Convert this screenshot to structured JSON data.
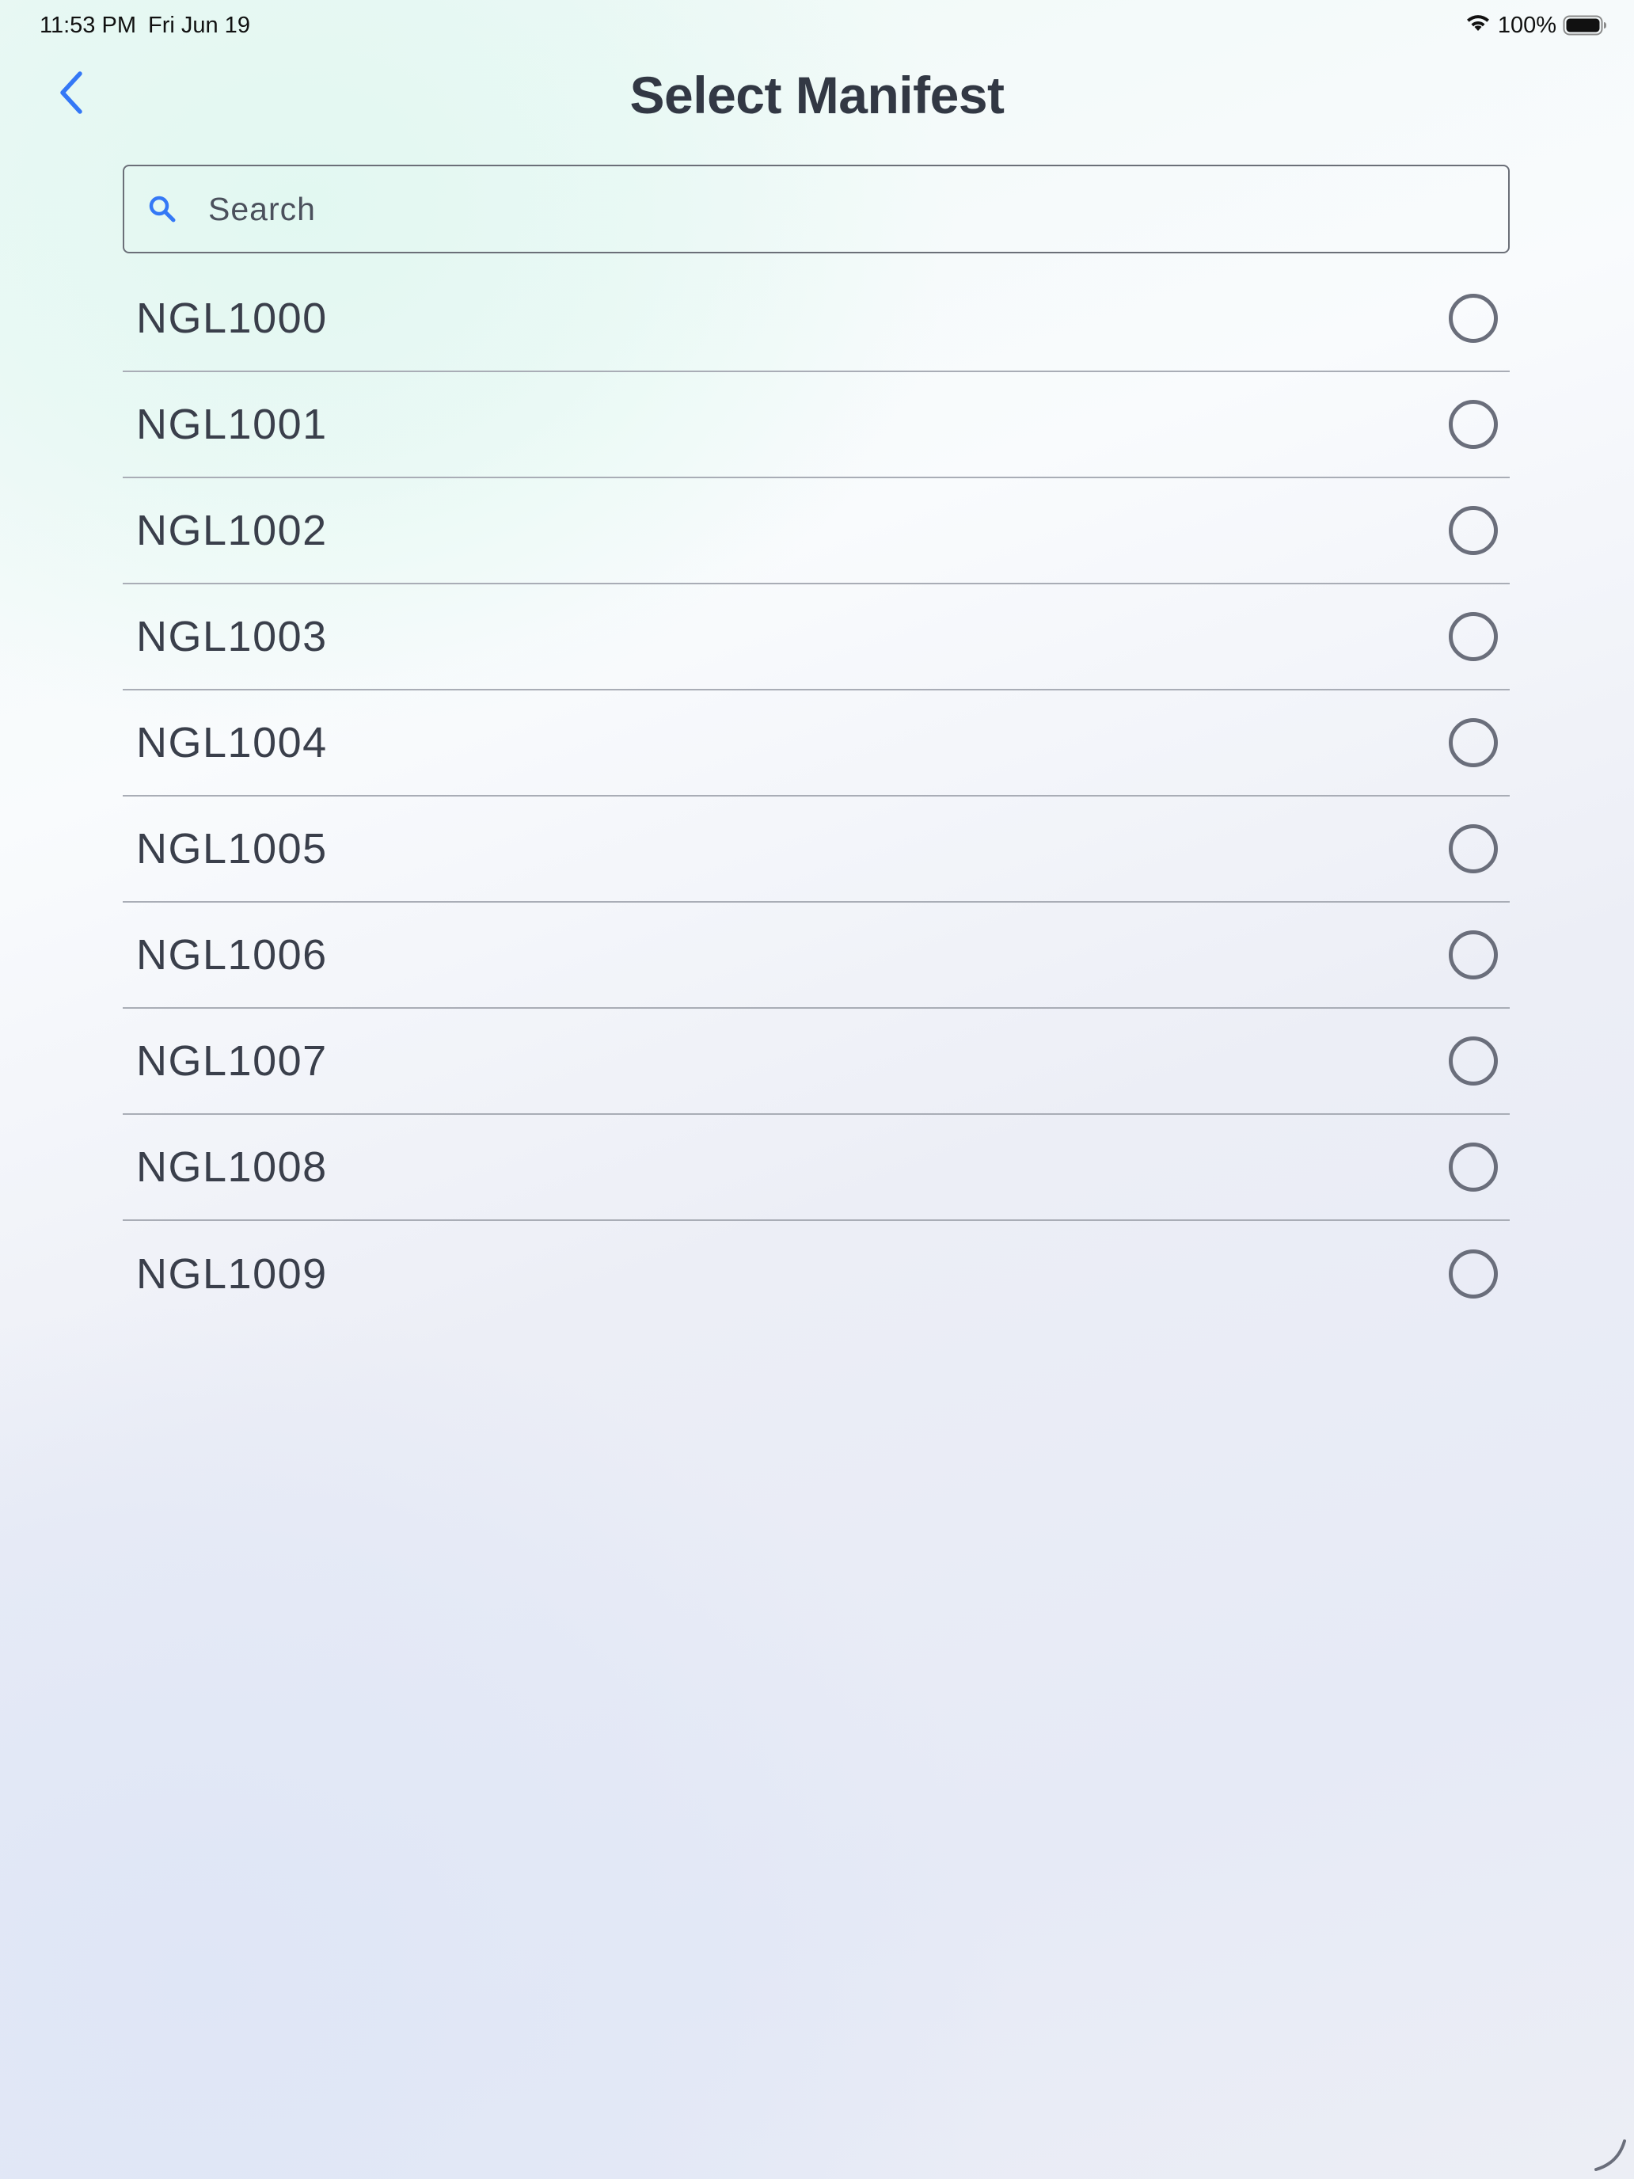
{
  "status_bar": {
    "time": "11:53 PM",
    "date": "Fri Jun 19",
    "battery_percent": "100%",
    "battery_level": 1.0,
    "icons": [
      "wifi-icon",
      "battery-icon"
    ]
  },
  "header": {
    "title": "Select Manifest",
    "back_icon": "chevron-left-icon",
    "accent_color": "#3478f6"
  },
  "search": {
    "placeholder": "Search",
    "value": "",
    "icon": "search-icon"
  },
  "manifests": [
    {
      "id": "NGL1000",
      "selected": false
    },
    {
      "id": "NGL1001",
      "selected": false
    },
    {
      "id": "NGL1002",
      "selected": false
    },
    {
      "id": "NGL1003",
      "selected": false
    },
    {
      "id": "NGL1004",
      "selected": false
    },
    {
      "id": "NGL1005",
      "selected": false
    },
    {
      "id": "NGL1006",
      "selected": false
    },
    {
      "id": "NGL1007",
      "selected": false
    },
    {
      "id": "NGL1008",
      "selected": false
    },
    {
      "id": "NGL1009",
      "selected": false
    }
  ],
  "colors": {
    "text": "#3a3f4b",
    "radio_border": "#6a6e7b",
    "divider": "#a9adb6"
  }
}
